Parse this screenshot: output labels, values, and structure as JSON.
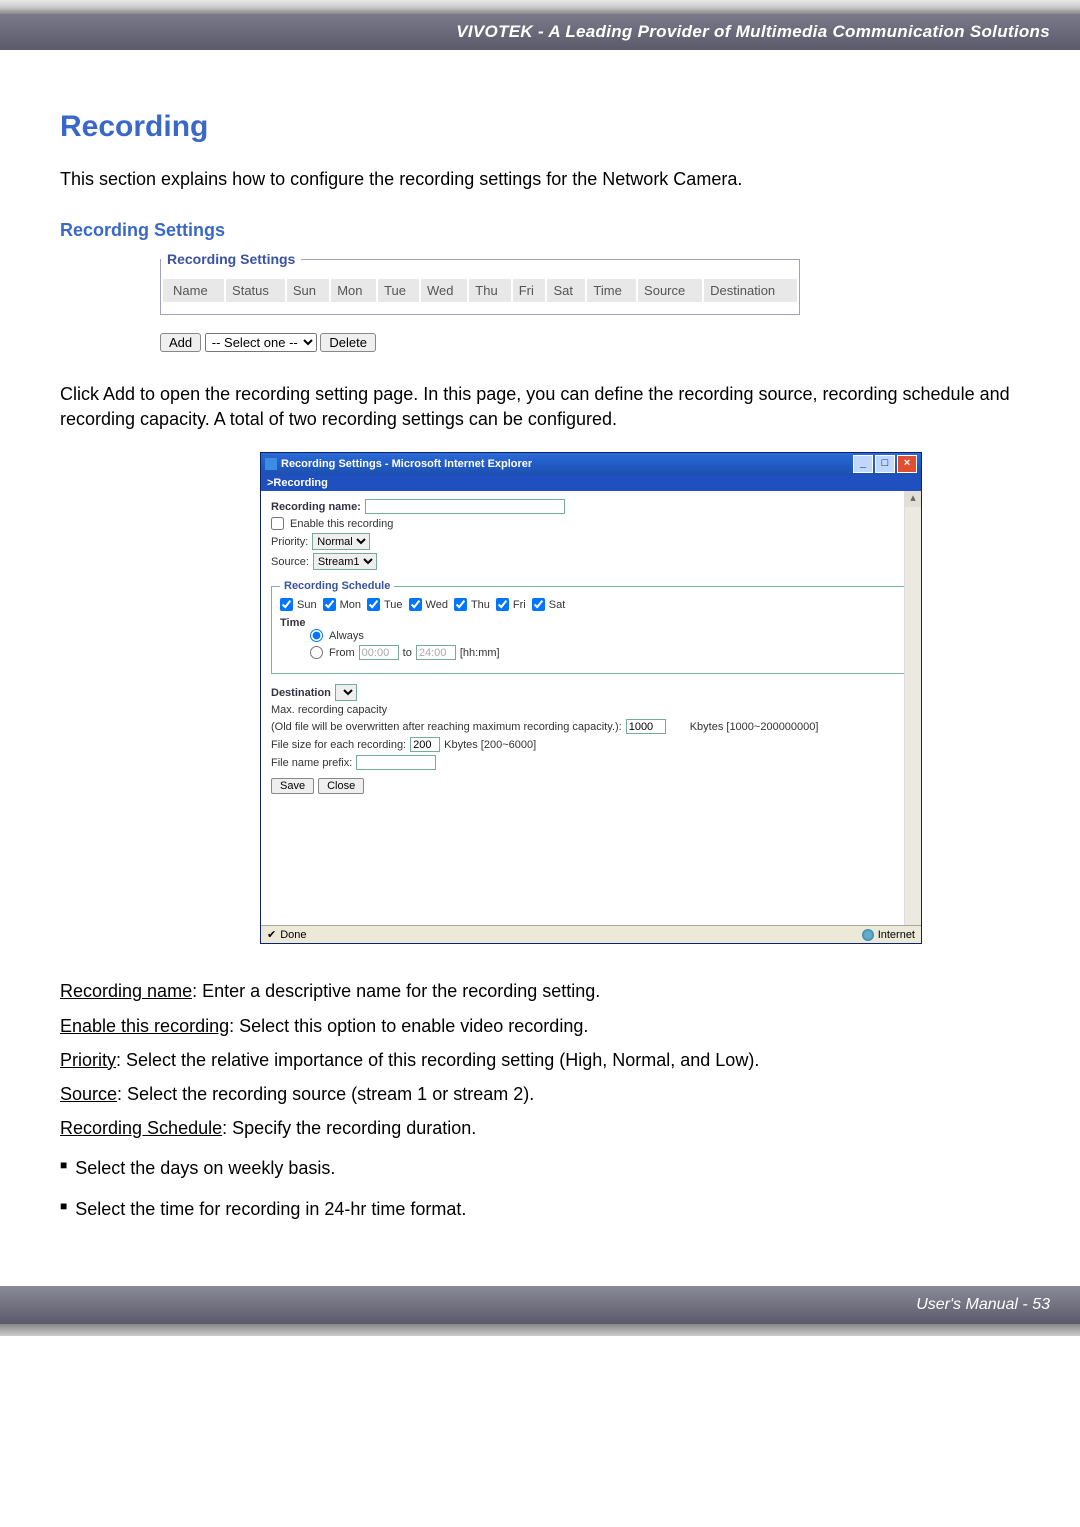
{
  "header": {
    "brand_line": "VIVOTEK - A Leading Provider of Multimedia Communication Solutions"
  },
  "page": {
    "title": "Recording",
    "intro": "This section explains how to configure the recording settings for the Network Camera.",
    "subheading": "Recording Settings"
  },
  "settings_panel": {
    "legend": "Recording Settings",
    "columns": [
      "Name",
      "Status",
      "Sun",
      "Mon",
      "Tue",
      "Wed",
      "Thu",
      "Fri",
      "Sat",
      "Time",
      "Source",
      "Destination"
    ],
    "add_label": "Add",
    "select_placeholder": "-- Select one --",
    "delete_label": "Delete"
  },
  "paragraph_after_panel": "Click Add to open the recording setting page. In this page, you can define the recording source, recording schedule and recording capacity. A total of two recording settings can be configured.",
  "ie_window": {
    "title": "Recording Settings - Microsoft Internet Explorer",
    "crumb": ">Recording",
    "recording_name_label": "Recording name:",
    "enable_label": "Enable this recording",
    "priority_label": "Priority:",
    "priority_value": "Normal",
    "source_label": "Source:",
    "source_value": "Stream1",
    "schedule_legend": "Recording Schedule",
    "days": [
      "Sun",
      "Mon",
      "Tue",
      "Wed",
      "Thu",
      "Fri",
      "Sat"
    ],
    "time_label": "Time",
    "always_label": "Always",
    "from_label": "From",
    "from_value": "00:00",
    "to_label": "to",
    "to_value": "24:00",
    "hhmm_label": "[hh:mm]",
    "destination_label": "Destination",
    "max_capacity_label": "Max. recording capacity",
    "overwrite_label": "(Old file will be overwritten after reaching maximum recording capacity.):",
    "overwrite_value": "1000",
    "overwrite_hint": "Kbytes [1000~200000000]",
    "filesize_label": "File size for each recording:",
    "filesize_value": "200",
    "filesize_hint": "Kbytes [200~6000]",
    "prefix_label": "File name prefix:",
    "save_label": "Save",
    "close_label": "Close",
    "status_done": "Done",
    "status_zone": "Internet"
  },
  "descriptions": {
    "recording_name_u": "Recording name",
    "recording_name_t": ": Enter a descriptive name for the recording setting.",
    "enable_u": "Enable this recording",
    "enable_t": ": Select this option to enable video recording.",
    "priority_u": "Priority",
    "priority_t": ": Select the relative importance of this recording setting (High, Normal, and Low).",
    "source_u": "Source",
    "source_t": ": Select the recording source (stream 1 or stream 2).",
    "schedule_u": "Recording Schedule",
    "schedule_t": ": Specify the recording duration.",
    "bullet1": "Select the days on weekly basis.",
    "bullet2": "Select the time for recording in 24-hr time format."
  },
  "footer": {
    "text": "User's Manual - 53"
  }
}
